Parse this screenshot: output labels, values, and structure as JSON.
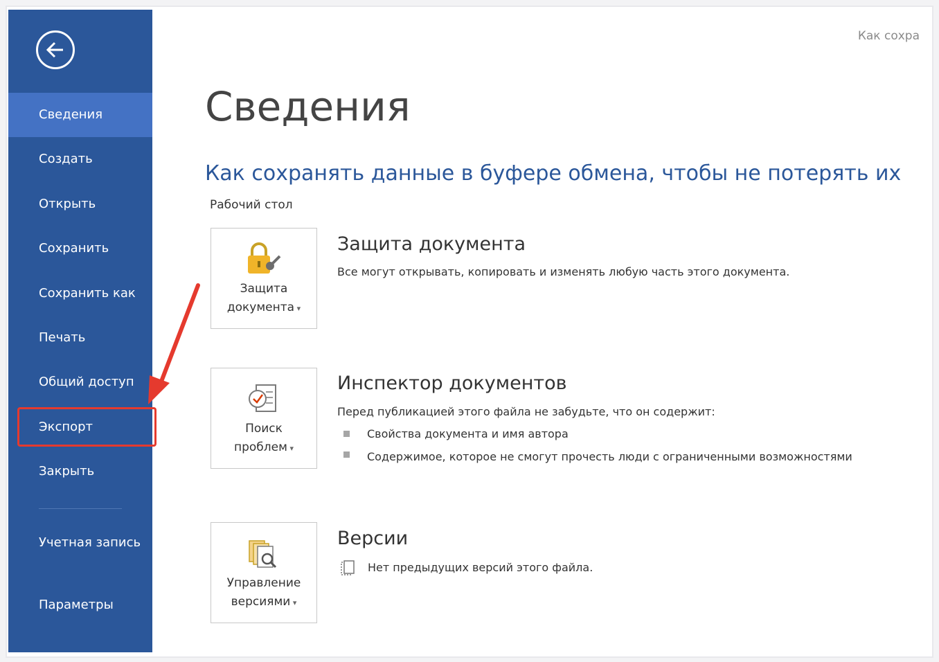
{
  "window": {
    "top_right_text": "Как сохра"
  },
  "sidebar": {
    "items": [
      {
        "label": "Сведения",
        "active": true
      },
      {
        "label": "Создать"
      },
      {
        "label": "Открыть"
      },
      {
        "label": "Сохранить"
      },
      {
        "label": "Сохранить как"
      },
      {
        "label": "Печать"
      },
      {
        "label": "Общий доступ"
      },
      {
        "label": "Экспорт",
        "highlighted": true
      },
      {
        "label": "Закрыть"
      },
      {
        "label": "Учетная запись"
      },
      {
        "label": "Параметры"
      }
    ],
    "back_icon": "arrow-left-circle-icon"
  },
  "main": {
    "page_title": "Сведения",
    "document_title": "Как сохранять данные в буфере обмена, чтобы не потерять их",
    "document_path": "Рабочий стол",
    "sections": {
      "protect": {
        "tile_line1": "Защита",
        "tile_line2": "документа",
        "heading": "Защита документа",
        "text": "Все могут открывать, копировать и изменять любую часть этого документа."
      },
      "inspect": {
        "tile_line1": "Поиск",
        "tile_line2": "проблем",
        "heading": "Инспектор документов",
        "text": "Перед публикацией этого файла не забудьте, что он содержит:",
        "bullets": [
          "Свойства документа и имя автора",
          "Содержимое, которое не смогут прочесть люди с ограниченными возможностями"
        ]
      },
      "versions": {
        "tile_line1": "Управление",
        "tile_line2": "версиями",
        "heading": "Версии",
        "text": "Нет предыдущих версий этого файла."
      }
    }
  },
  "colors": {
    "sidebar_bg": "#2b579a",
    "sidebar_active": "#4472c4",
    "title_blue": "#2b579a",
    "annotation_red": "#e53a2e"
  }
}
